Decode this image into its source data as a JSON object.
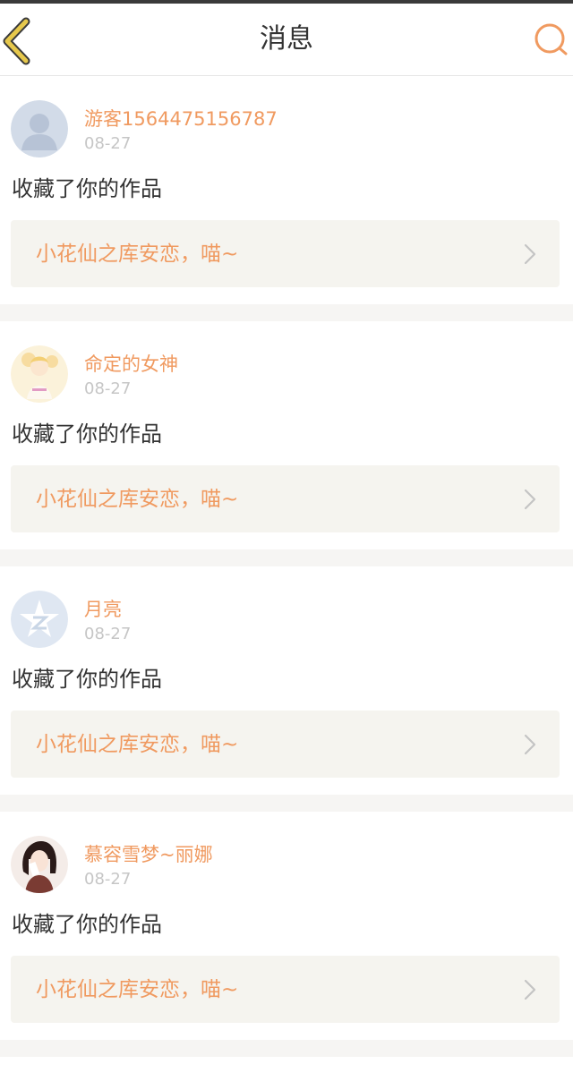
{
  "header": {
    "title": "消息",
    "back_icon": "chevron-left-icon",
    "search_icon": "search-icon",
    "accent_back": "#e6c84c",
    "accent_search": "#f09a60"
  },
  "colors": {
    "name": "#f09a60",
    "work_title": "#f09a60",
    "date": "#c6c6c6",
    "text": "#333333",
    "work_bg": "#f5f4ef",
    "separator": "#f6f5f3"
  },
  "messages": [
    {
      "user": "游客1564475156787",
      "date": "08-27",
      "action": "收藏了你的作品",
      "work": "小花仙之库安恋，喵~",
      "avatar": "default-user-avatar"
    },
    {
      "user": "命定的女神",
      "date": "08-27",
      "action": "收藏了你的作品",
      "work": "小花仙之库安恋，喵~",
      "avatar": "fairy-girl-avatar"
    },
    {
      "user": "月亮",
      "date": "08-27",
      "action": "收藏了你的作品",
      "work": "小花仙之库安恋，喵~",
      "avatar": "qzone-star-avatar"
    },
    {
      "user": "慕容雪梦~丽娜",
      "date": "08-27",
      "action": "收藏了你的作品",
      "work": "小花仙之库安恋，喵~",
      "avatar": "anime-girl-avatar"
    }
  ]
}
